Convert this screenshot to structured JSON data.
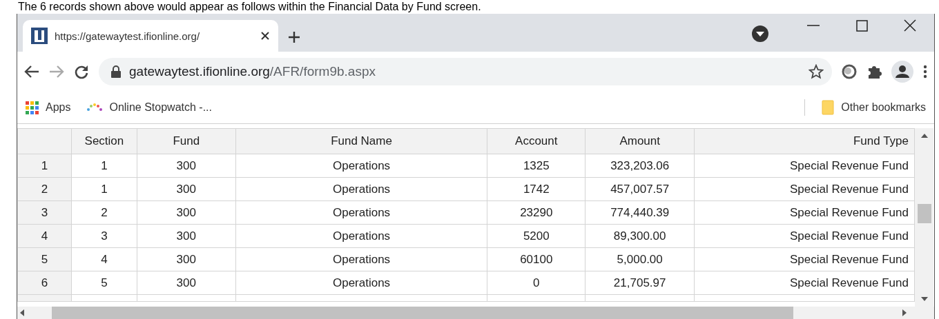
{
  "caption": "The 6 records shown above would appear as follows within the Financial Data by Fund screen.",
  "browser": {
    "tab": {
      "title": "https://gatewaytest.ifionline.org/",
      "selected": true
    },
    "address": {
      "host": "gatewaytest.ifionline.org",
      "path": "/AFR/form9b.aspx"
    },
    "bookmarks": [
      {
        "label": "Apps",
        "kind": "apps"
      },
      {
        "label": "Online Stopwatch -...",
        "kind": "site"
      }
    ],
    "other_bookmarks": "Other bookmarks"
  },
  "table": {
    "columns": [
      "",
      "Section",
      "Fund",
      "Fund Name",
      "Account",
      "Amount",
      "Fund Type"
    ],
    "rows": [
      [
        "1",
        "1",
        "300",
        "Operations",
        "1325",
        "323,203.06",
        "Special Revenue Fund"
      ],
      [
        "2",
        "1",
        "300",
        "Operations",
        "1742",
        "457,007.57",
        "Special Revenue Fund"
      ],
      [
        "3",
        "2",
        "300",
        "Operations",
        "23290",
        "774,440.39",
        "Special Revenue Fund"
      ],
      [
        "4",
        "3",
        "300",
        "Operations",
        "5200",
        "89,300.00",
        "Special Revenue Fund"
      ],
      [
        "5",
        "4",
        "300",
        "Operations",
        "60100",
        "5,000.00",
        "Special Revenue Fund"
      ],
      [
        "6",
        "5",
        "300",
        "Operations",
        "0",
        "21,705.97",
        "Special Revenue Fund"
      ]
    ]
  }
}
